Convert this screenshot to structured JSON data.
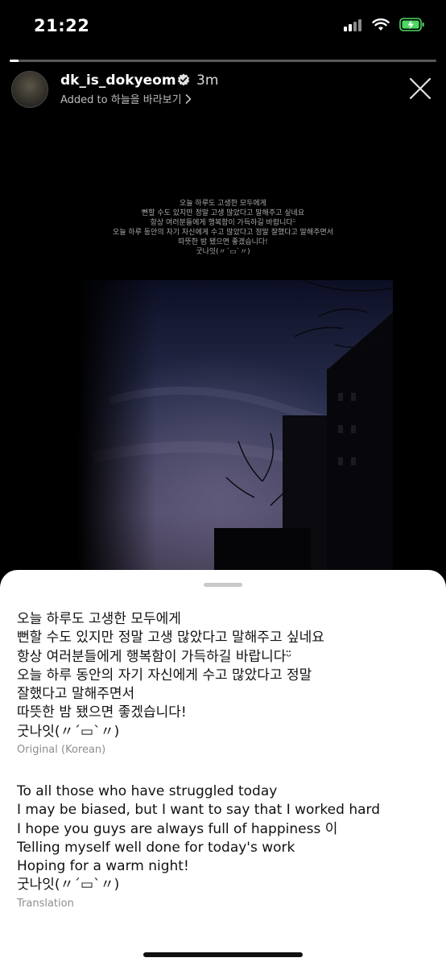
{
  "status_bar": {
    "time": "21:22",
    "icons": [
      "cellular-signal-icon",
      "wifi-icon",
      "battery-charging-icon"
    ],
    "battery_color": "#4cd964"
  },
  "story": {
    "progress": 0.02,
    "username": "dk_is_dokyeom",
    "verified": true,
    "time_ago": "3m",
    "added_to_label": "Added to 하늘을 바라보기",
    "caption_lines": [
      "오늘 하루도 고생한 모두에게",
      "뻔할 수도 있지만 정말 고생 많았다고 말해주고 싶네요",
      "항상 여러분들에게 행복함이 가득하길 바랍니다ᵕ̈",
      "오늘 하루 동안의 자기 자신에게 수고 많았다고 정말 잘했다고 말해주면서",
      "따뜻한 밤 됐으면 좋겠습니다!",
      "굿나잇(〃´▭`〃)"
    ]
  },
  "translation_sheet": {
    "original_text": "오늘 하루도 고생한 모두에게\n뻔할 수도 있지만 정말 고생 많았다고 말해주고 싶네요\n항상 여러분들에게 행복함이 가득하길 바랍니다ᵕ̈\n오늘 하루 동안의 자기 자신에게 수고 많았다고 정말\n잘했다고 말해주면서\n따뜻한 밤 됐으면 좋겠습니다!\n굿나잇(〃´▭`〃)",
    "original_label": "Original (Korean)",
    "translated_text": "To all those who have struggled today\nI may be biased, but I want to say that I worked hard\nI hope you guys are always full of happiness 이\nTelling myself well done for today's work\nHoping for a warm night!\n 굿나잇(〃´▭`〃)",
    "translated_label": "Translation"
  }
}
